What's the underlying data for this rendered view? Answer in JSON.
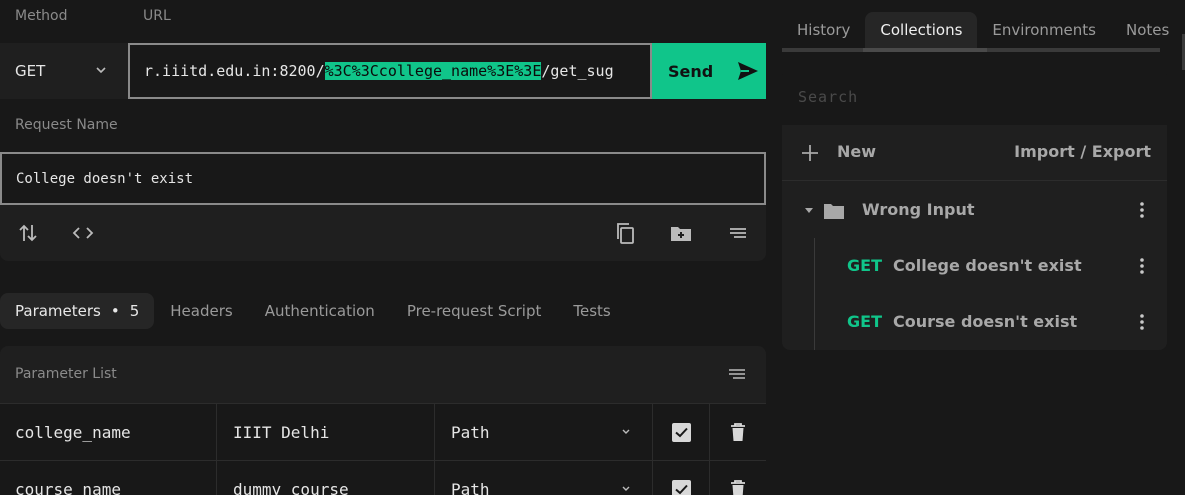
{
  "request": {
    "method_label": "Method",
    "url_label": "URL",
    "method": "GET",
    "url_prefix": "r.iiitd.edu.in:8200/",
    "url_highlight": "%3C%3Ccollege_name%3E%3E",
    "url_suffix": "/get_sug",
    "send_label": "Send",
    "request_name_label": "Request Name",
    "request_name": "College doesn't exist"
  },
  "tabs": {
    "parameters": "Parameters",
    "parameters_count": "5",
    "headers": "Headers",
    "authentication": "Authentication",
    "prerequest": "Pre-request Script",
    "tests": "Tests"
  },
  "params": {
    "title": "Parameter List",
    "rows": [
      {
        "key": "college_name",
        "value": "IIIT Delhi",
        "type": "Path",
        "enabled": true
      },
      {
        "key": "course_name",
        "value": "dummy_course",
        "type": "Path",
        "enabled": true
      }
    ]
  },
  "sidebar": {
    "tabs": [
      "History",
      "Collections",
      "Environments",
      "Notes"
    ],
    "active_tab": "Collections",
    "search_placeholder": "Search",
    "new_label": "New",
    "import_export_label": "Import / Export",
    "folder_name": "Wrong Input",
    "requests": [
      {
        "method": "GET",
        "name": "College doesn't exist"
      },
      {
        "method": "GET",
        "name": "Course doesn't exist"
      }
    ]
  },
  "colors": {
    "accent": "#10c58a",
    "background": "#181818",
    "panel": "#1f1f1f"
  }
}
